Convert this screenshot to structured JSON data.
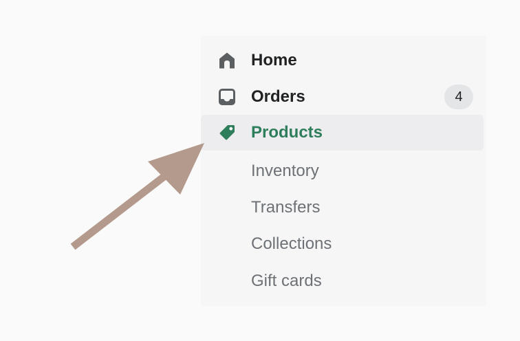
{
  "nav": {
    "items": [
      {
        "label": "Home",
        "icon": "home-icon"
      },
      {
        "label": "Orders",
        "icon": "inbox-icon",
        "badge": "4"
      },
      {
        "label": "Products",
        "icon": "tag-icon",
        "active": true
      },
      {
        "label": "Inventory"
      },
      {
        "label": "Transfers"
      },
      {
        "label": "Collections"
      },
      {
        "label": "Gift cards"
      }
    ]
  },
  "colors": {
    "accent": "#2e7d5b",
    "arrow": "#b49a8c",
    "panel": "#f6f6f7",
    "active_row": "#ededef",
    "icon": "#5c5f62"
  }
}
